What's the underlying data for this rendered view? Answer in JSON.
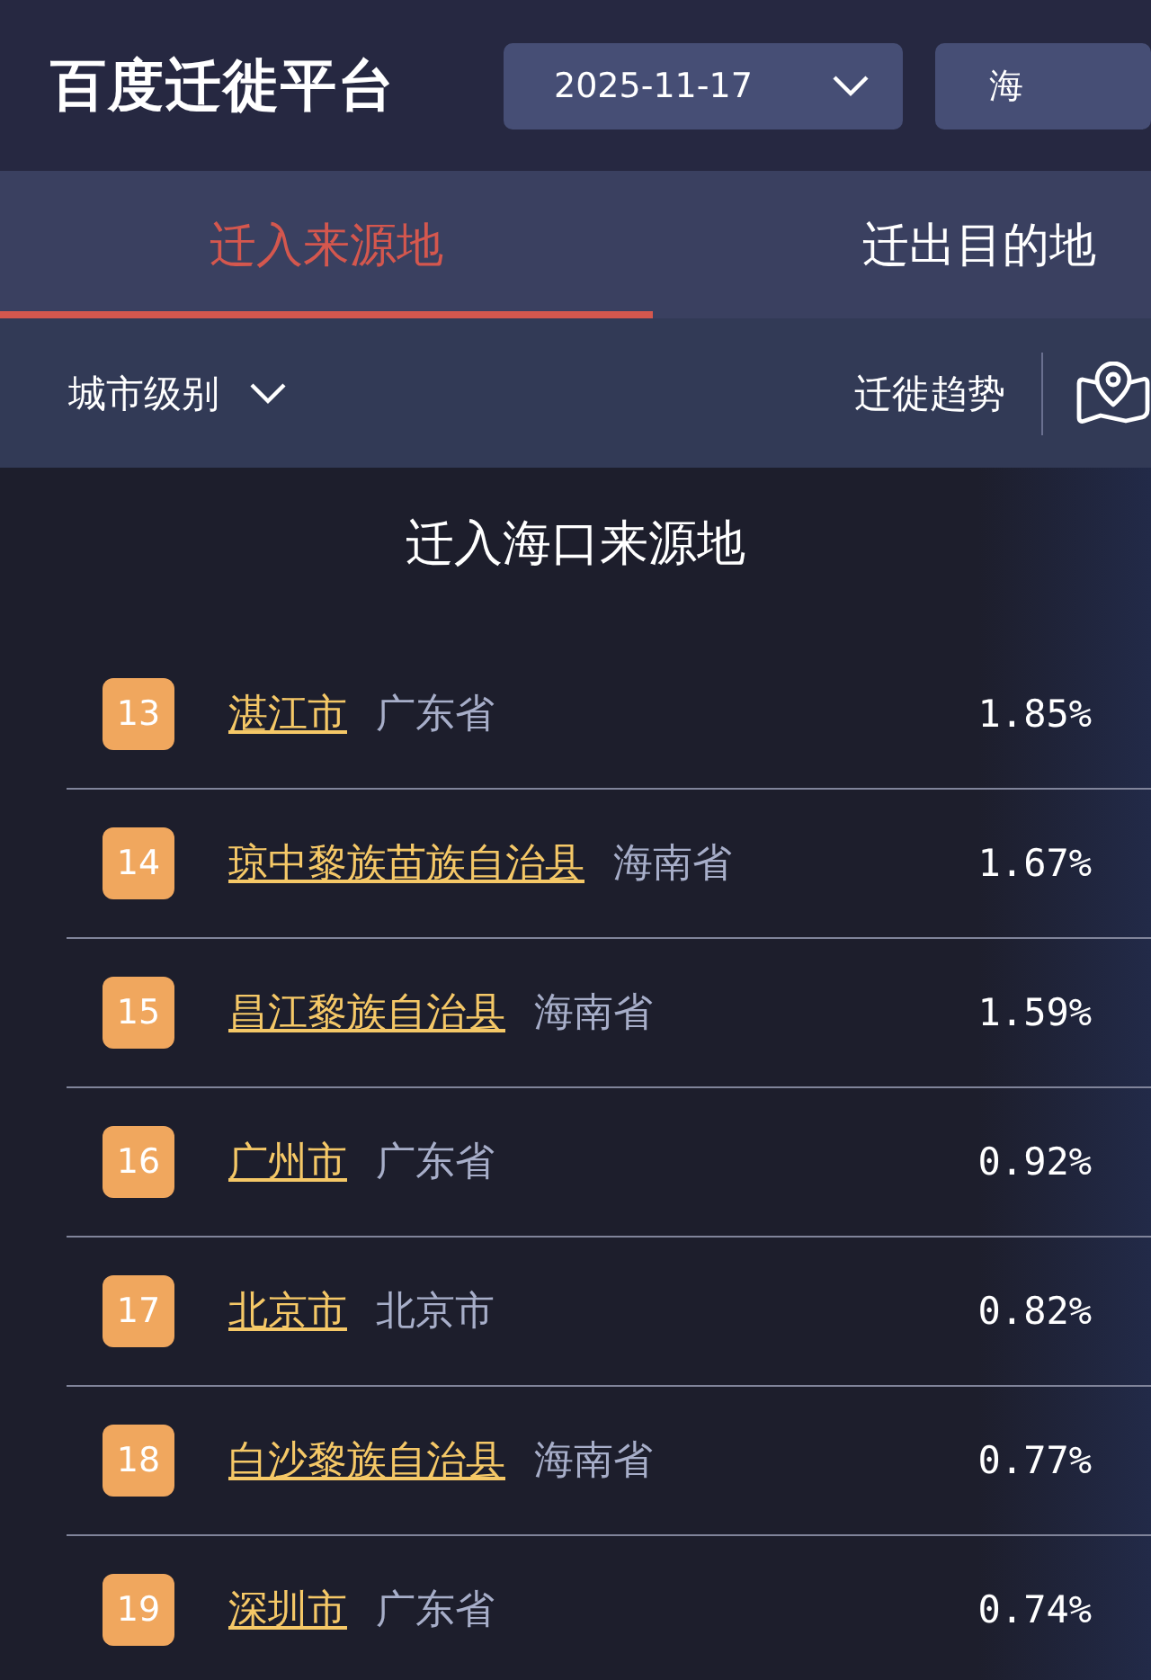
{
  "header": {
    "logo": "百度迁徙平台",
    "date": "2025-11-17",
    "city": "海"
  },
  "tabs": [
    {
      "label": "迁入来源地",
      "selected": true
    },
    {
      "label": "迁出目的地",
      "selected": false
    }
  ],
  "filter": {
    "city_level": "城市级别",
    "trend": "迁徙趋势"
  },
  "list": {
    "title": "迁入海口来源地",
    "rows": [
      {
        "rank": "13",
        "city": "湛江市",
        "province": "广东省",
        "share": "1.85%"
      },
      {
        "rank": "14",
        "city": "琼中黎族苗族自治县",
        "province": "海南省",
        "share": "1.67%"
      },
      {
        "rank": "15",
        "city": "昌江黎族自治县",
        "province": "海南省",
        "share": "1.59%"
      },
      {
        "rank": "16",
        "city": "广州市",
        "province": "广东省",
        "share": "0.92%"
      },
      {
        "rank": "17",
        "city": "北京市",
        "province": "北京市",
        "share": "0.82%"
      },
      {
        "rank": "18",
        "city": "白沙黎族自治县",
        "province": "海南省",
        "share": "0.77%"
      },
      {
        "rank": "19",
        "city": "深圳市",
        "province": "广东省",
        "share": "0.74%"
      }
    ]
  }
}
